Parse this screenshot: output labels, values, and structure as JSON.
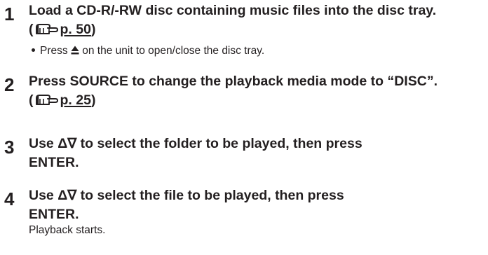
{
  "steps": [
    {
      "number": "1",
      "title_before": "Load a CD-R/-RW disc containing music files into the disc tray.",
      "ref_open": "(",
      "ref_page": "p. 50",
      "ref_close": ")",
      "bullet_before": "Press",
      "bullet_icon": "eject-icon",
      "bullet_after": "on the unit to open/close the disc tray."
    },
    {
      "number": "2",
      "title_before": "Press SOURCE to change the playback media mode to “DISC”.",
      "ref_open": "(",
      "ref_page": "p. 25",
      "ref_close": ")"
    },
    {
      "number": "3",
      "title_line1": "Use Δ∇ to select the folder to be played, then press",
      "title_line2": "ENTER."
    },
    {
      "number": "4",
      "title_line1": "Use Δ∇ to select the file to be played, then press",
      "title_line2": "ENTER.",
      "note": "Playback starts."
    }
  ],
  "icons": {
    "reference": "pointing-hand-icon",
    "eject": "eject-icon"
  },
  "colors": {
    "text": "#231f20",
    "background": "#ffffff"
  }
}
